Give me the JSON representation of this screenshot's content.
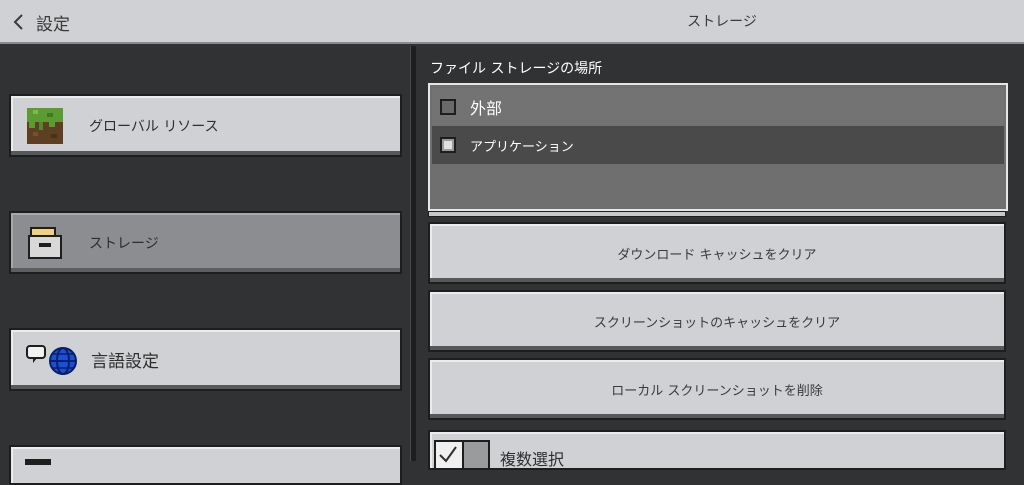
{
  "header": {
    "back_label": "設定",
    "title": "ストレージ"
  },
  "sidebar": {
    "items": [
      {
        "label": "グローバル リソース",
        "icon": "grass-block-icon",
        "selected": false
      },
      {
        "label": "ストレージ",
        "icon": "folder-icon",
        "selected": true
      },
      {
        "label": "言語設定",
        "icon": "language-globe-icon",
        "selected": false
      }
    ]
  },
  "storage": {
    "section_title": "ファイル ストレージの場所",
    "options": [
      {
        "label": "外部",
        "checked": false
      },
      {
        "label": "アプリケーション",
        "checked": true
      }
    ]
  },
  "actions": {
    "clear_download_cache": "ダウンロード キャッシュをクリア",
    "clear_screenshot_cache": "スクリーンショットのキャッシュをクリア",
    "delete_local_screenshots": "ローカル スクリーンショットを削除"
  },
  "multi_select": {
    "label": "複数選択",
    "enabled": true
  },
  "colors": {
    "background": "#313233",
    "button": "#d0d1d4",
    "selected": "#8c8d90"
  }
}
